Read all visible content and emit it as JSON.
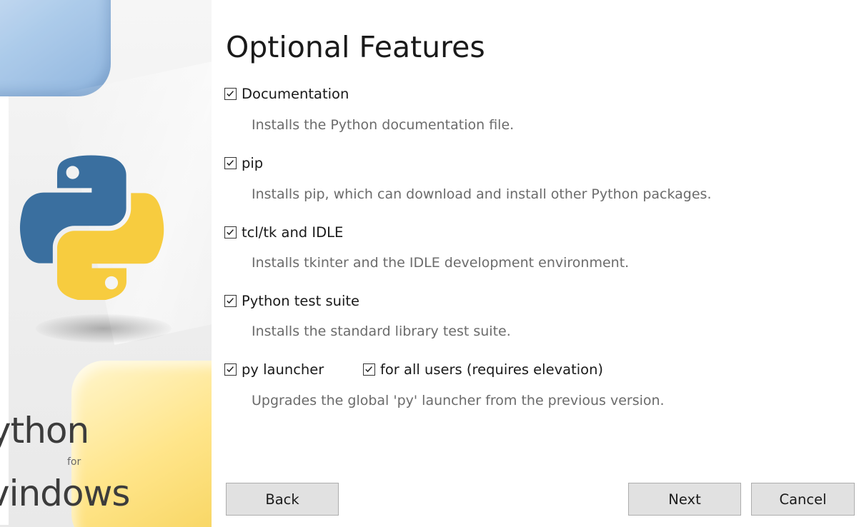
{
  "banner": {
    "brand_python": "ython",
    "brand_for": "for",
    "brand_windows": "vindows",
    "logo_icon": "python-logo-icon",
    "colors": {
      "logo_blue": "#3a6f9f",
      "logo_yellow": "#f7cc3f"
    }
  },
  "title": "Optional Features",
  "options": [
    {
      "label": "Documentation",
      "checked": true,
      "description": "Installs the Python documentation file."
    },
    {
      "label": "pip",
      "checked": true,
      "description": "Installs pip, which can download and install other Python packages."
    },
    {
      "label": "tcl/tk and IDLE",
      "checked": true,
      "description": "Installs tkinter and the IDLE development environment."
    },
    {
      "label": "Python test suite",
      "checked": true,
      "description": "Installs the standard library test suite."
    },
    {
      "label": "py launcher",
      "checked": true,
      "description": "Upgrades the global 'py' launcher from the previous version."
    }
  ],
  "for_all_users": {
    "label": "for all users (requires elevation)",
    "checked": true
  },
  "buttons": {
    "back": "Back",
    "next": "Next",
    "cancel": "Cancel"
  }
}
